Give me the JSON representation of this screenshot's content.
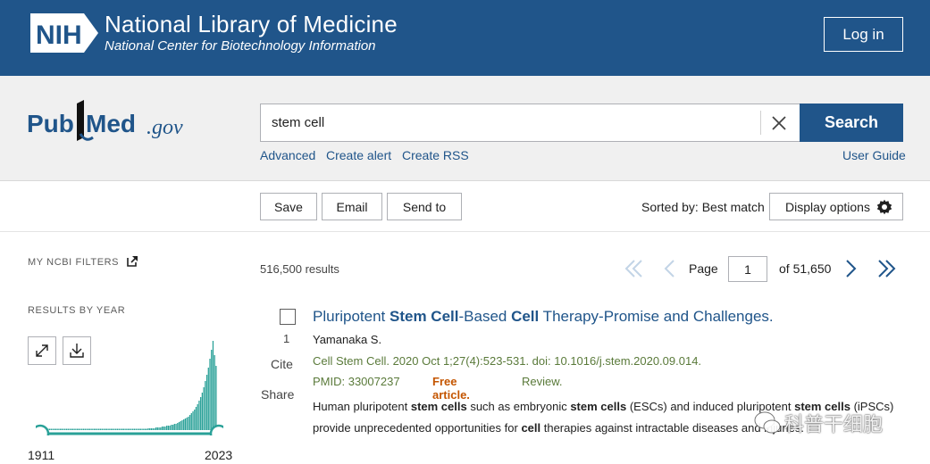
{
  "header": {
    "nih_logo_text": "NIH",
    "title": "National Library of Medicine",
    "subtitle": "National Center for Biotechnology Information",
    "login_label": "Log in"
  },
  "search": {
    "logo_text_pub": "Pub",
    "logo_text_med": "Med",
    "logo_text_gov": ".gov",
    "query": "stem cell",
    "button_label": "Search",
    "links": {
      "advanced": "Advanced",
      "create_alert": "Create alert",
      "create_rss": "Create RSS",
      "user_guide": "User Guide"
    }
  },
  "toolbar": {
    "save": "Save",
    "email": "Email",
    "send_to": "Send to",
    "sorted_by": "Sorted by: Best match",
    "display_options": "Display options"
  },
  "sidebar": {
    "filters_heading": "MY NCBI FILTERS",
    "results_by_year_heading": "RESULTS BY YEAR",
    "year_start": "1911",
    "year_end": "2023"
  },
  "results": {
    "count": "516,500 results",
    "page_label": "Page",
    "page_value": "1",
    "page_of": "of 51,650",
    "items": [
      {
        "number": "1",
        "cite": "Cite",
        "share": "Share",
        "title_parts": [
          "Pluripotent ",
          "Stem Cell",
          "-Based ",
          "Cell",
          " Therapy-Promise and Challenges."
        ],
        "authors": "Yamanaka S.",
        "citation": "Cell Stem Cell. 2020 Oct 1;27(4):523-531. doi: 10.1016/j.stem.2020.09.014.",
        "pmid": "PMID: 33007237",
        "free": "Free article.",
        "type": "Review.",
        "snippet_parts": [
          "Human pluripotent ",
          "stem cells",
          " such as embryonic ",
          "stem cells",
          " (ESCs) and induced pluripotent ",
          "stem cells",
          " (iPSCs) provide unprecedented opportunities for ",
          "cell",
          " therapies against intractable diseases and injuries."
        ]
      }
    ]
  },
  "watermark": {
    "text": "科普干细胞"
  },
  "colors": {
    "nih_blue": "#20558a",
    "link_blue": "#20558a",
    "free_orange": "#c45500",
    "journal_green": "#5a7a3a",
    "histogram_teal": "#2aa198"
  },
  "histogram": {
    "type": "bar",
    "note_values_relative": true,
    "values": [
      1,
      1,
      1,
      1,
      1,
      1,
      1,
      1,
      1,
      1,
      1,
      1,
      1,
      1,
      1,
      1,
      1,
      1,
      1,
      1,
      1,
      1,
      1,
      1,
      1,
      1,
      1,
      1,
      1,
      1,
      1,
      1,
      1,
      1,
      1,
      1,
      1,
      1,
      1,
      1,
      1,
      1,
      1,
      1,
      1,
      1,
      1,
      1,
      1,
      1,
      1,
      1,
      1,
      1,
      1,
      1,
      1,
      1,
      1,
      1,
      1,
      1,
      1,
      1,
      1,
      1,
      1,
      1,
      2,
      2,
      2,
      2,
      2,
      3,
      3,
      3,
      3,
      4,
      4,
      4,
      5,
      5,
      5,
      6,
      6,
      7,
      7,
      8,
      9,
      10,
      11,
      12,
      13,
      14,
      15,
      17,
      19,
      21,
      23,
      26,
      29,
      33,
      37,
      42,
      48,
      55,
      62,
      70,
      80,
      90,
      100,
      84,
      72
    ]
  }
}
